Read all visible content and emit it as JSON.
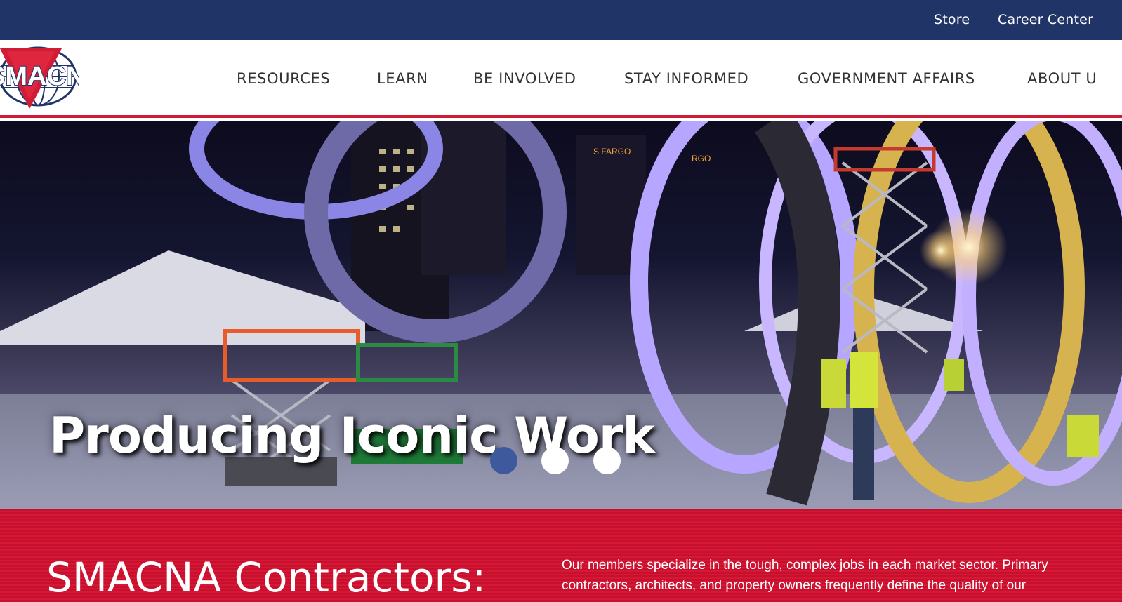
{
  "topbar": {
    "store": "Store",
    "career_center": "Career Center",
    "background": "#213468"
  },
  "logo": {
    "text": "SMACNA",
    "icon": "globe-triangle-logo",
    "colors": {
      "red": "#d01c34",
      "blue": "#213468"
    }
  },
  "nav": {
    "items": [
      {
        "label": "RESOURCES"
      },
      {
        "label": "LEARN"
      },
      {
        "label": "BE INVOLVED"
      },
      {
        "label": "STAY INFORMED"
      },
      {
        "label": "GOVERNMENT AFFAIRS"
      },
      {
        "label": "ABOUT U"
      }
    ],
    "accent": "#d01c34"
  },
  "hero": {
    "title": "Producing Iconic Work",
    "slides": {
      "count": 3,
      "active_index": 0
    },
    "dot_active_color": "#3e5a9c",
    "dot_inactive_color": "#ffffff"
  },
  "intro": {
    "heading": "SMACNA Contractors:",
    "text": "Our members specialize in the tough, complex jobs in each market sector. Primary contractors, architects, and property owners frequently define the quality of our",
    "background": "#c8102e"
  }
}
